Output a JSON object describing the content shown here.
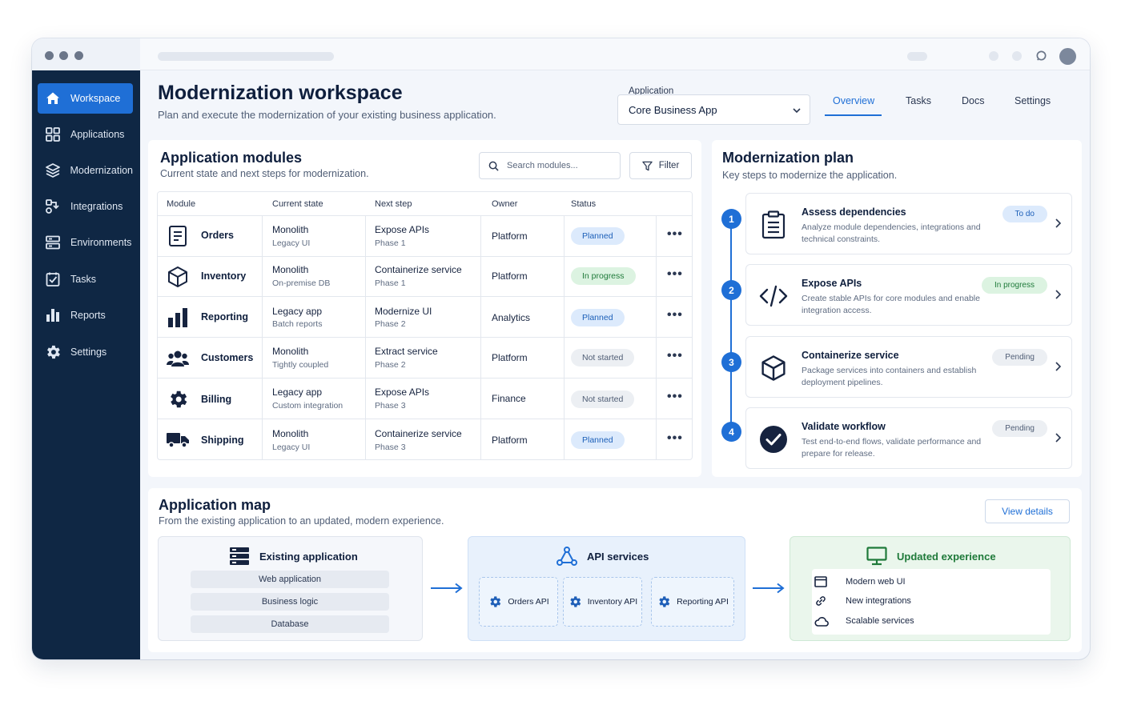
{
  "colors": {
    "accent": "#1f6fd6",
    "sidebar": "#0f2744",
    "success": "#1f7a3a"
  },
  "sidebar": {
    "items": [
      {
        "label": "Workspace",
        "icon": "home-icon",
        "active": true
      },
      {
        "label": "Applications",
        "icon": "grid-icon"
      },
      {
        "label": "Modernization",
        "icon": "layers-icon"
      },
      {
        "label": "Integrations",
        "icon": "integrations-icon"
      },
      {
        "label": "Environments",
        "icon": "server-icon"
      },
      {
        "label": "Tasks",
        "icon": "checkbox-icon"
      },
      {
        "label": "Reports",
        "icon": "bar-chart-icon"
      },
      {
        "label": "Settings",
        "icon": "gear-icon"
      }
    ]
  },
  "header": {
    "title": "Modernization workspace",
    "subtitle": "Plan and execute the modernization of your existing business application.",
    "app_label": "Application",
    "app_value": "Core Business App",
    "tabs": [
      "Overview",
      "Tasks",
      "Docs",
      "Settings"
    ],
    "active_tab": "Overview"
  },
  "modules": {
    "title": "Application modules",
    "subtitle": "Current state and next steps for modernization.",
    "search_placeholder": "Search modules...",
    "filter_label": "Filter",
    "columns": [
      "Module",
      "Current state",
      "Next step",
      "Owner",
      "Status"
    ],
    "rows": [
      {
        "icon": "document-icon",
        "name": "Orders",
        "state": "Monolith",
        "state_sub": "Legacy UI",
        "next": "Expose APIs",
        "next_sub": "Phase 1",
        "owner": "Platform",
        "status": "Planned",
        "status_kind": "planned"
      },
      {
        "icon": "cube-icon",
        "name": "Inventory",
        "state": "Monolith",
        "state_sub": "On-premise DB",
        "next": "Containerize service",
        "next_sub": "Phase 1",
        "owner": "Platform",
        "status": "In progress",
        "status_kind": "progress"
      },
      {
        "icon": "bar-chart-icon",
        "name": "Reporting",
        "state": "Legacy app",
        "state_sub": "Batch reports",
        "next": "Modernize UI",
        "next_sub": "Phase 2",
        "owner": "Analytics",
        "status": "Planned",
        "status_kind": "planned"
      },
      {
        "icon": "users-icon",
        "name": "Customers",
        "state": "Monolith",
        "state_sub": "Tightly coupled",
        "next": "Extract service",
        "next_sub": "Phase 2",
        "owner": "Platform",
        "status": "Not started",
        "status_kind": "notstarted"
      },
      {
        "icon": "gear-icon",
        "name": "Billing",
        "state": "Legacy app",
        "state_sub": "Custom integration",
        "next": "Expose APIs",
        "next_sub": "Phase 3",
        "owner": "Finance",
        "status": "Not started",
        "status_kind": "notstarted"
      },
      {
        "icon": "truck-icon",
        "name": "Shipping",
        "state": "Monolith",
        "state_sub": "Legacy UI",
        "next": "Containerize service",
        "next_sub": "Phase 3",
        "owner": "Platform",
        "status": "Planned",
        "status_kind": "planned"
      }
    ],
    "row_menu": "•••"
  },
  "plan": {
    "title": "Modernization plan",
    "subtitle": "Key steps to modernize the application.",
    "steps": [
      {
        "num": "1",
        "icon": "clipboard-icon",
        "title": "Assess dependencies",
        "desc": "Analyze module dependencies, integrations and technical constraints.",
        "status": "To do",
        "status_kind": "todo"
      },
      {
        "num": "2",
        "icon": "code-icon",
        "title": "Expose APIs",
        "desc": "Create stable APIs for core modules and enable integration access.",
        "status": "In progress",
        "status_kind": "progress"
      },
      {
        "num": "3",
        "icon": "cube-icon",
        "title": "Containerize service",
        "desc": "Package services into containers and establish deployment pipelines.",
        "status": "Pending",
        "status_kind": "pending"
      },
      {
        "num": "4",
        "icon": "check-circle-icon",
        "title": "Validate workflow",
        "desc": "Test end-to-end flows, validate performance and prepare for release.",
        "status": "Pending",
        "status_kind": "pending"
      }
    ]
  },
  "map": {
    "title": "Application map",
    "subtitle": "From the existing application to an updated, modern experience.",
    "view_details": "View details",
    "existing": {
      "title": "Existing application",
      "layers": [
        "Web application",
        "Business logic",
        "Database"
      ]
    },
    "api": {
      "title": "API services",
      "items": [
        "Orders API",
        "Inventory API",
        "Reporting API"
      ]
    },
    "updated": {
      "title": "Updated experience",
      "items": [
        {
          "icon": "browser-icon",
          "label": "Modern web UI"
        },
        {
          "icon": "link-icon",
          "label": "New integrations"
        },
        {
          "icon": "cloud-icon",
          "label": "Scalable services"
        }
      ]
    }
  }
}
